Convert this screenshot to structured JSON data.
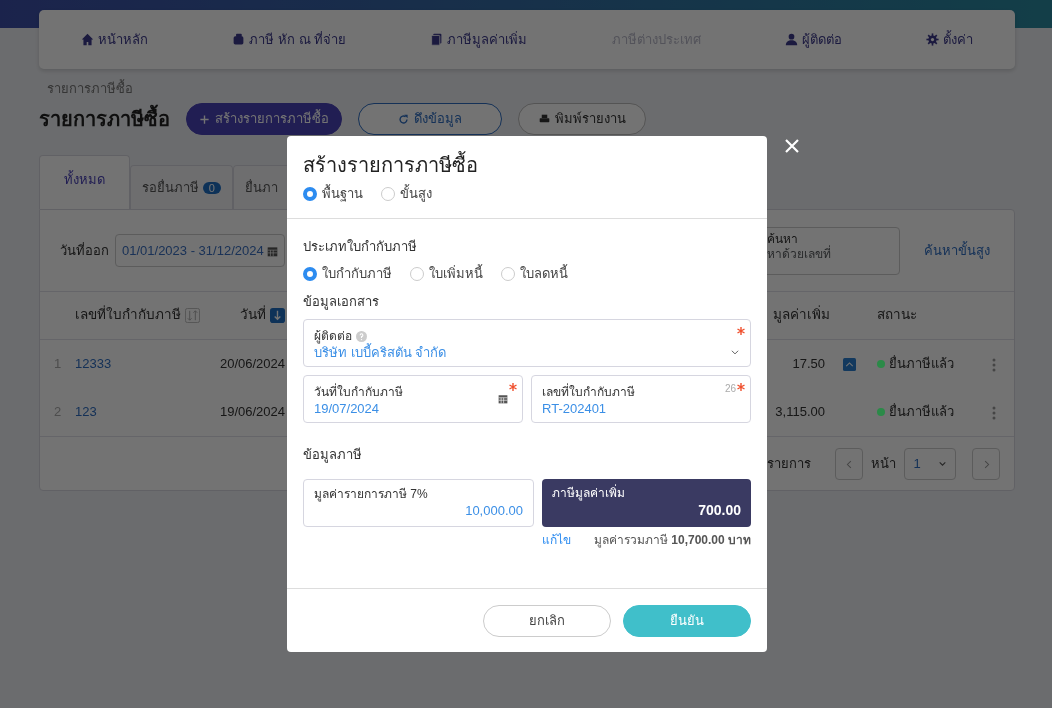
{
  "navbar": {
    "items": [
      {
        "label": "หน้าหลัก",
        "disabled": false
      },
      {
        "label": "ภาษี หัก ณ ที่จ่าย",
        "disabled": false
      },
      {
        "label": "ภาษีมูลค่าเพิ่ม",
        "disabled": false
      },
      {
        "label": "ภาษีต่างประเทศ",
        "disabled": true
      },
      {
        "label": "ผู้ติดต่อ",
        "disabled": false
      },
      {
        "label": "ตั้งค่า",
        "disabled": false
      }
    ]
  },
  "breadcrumb": "รายการภาษีซื้อ",
  "page_title": "รายการภาษีซื้อ",
  "actions": [
    {
      "label": "สร้างรายการภาษีซื้อ",
      "kind": "primary"
    },
    {
      "label": "ดึงข้อมูล",
      "kind": "outline"
    },
    {
      "label": "พิมพ์รายงาน",
      "kind": "secondary"
    }
  ],
  "tabs": [
    {
      "label": "ทั้งหมด",
      "selected": true
    },
    {
      "label": "รอยื่นภาษี",
      "count": "0",
      "selected": false
    },
    {
      "label": "ยื่นภา",
      "selected": false
    }
  ],
  "filters": {
    "date_label": "วันที่ออก",
    "date_range": "01/01/2023 - 31/12/2024",
    "search_label": "ค้นหา",
    "search_placeholder": "หาด้วยเลขที่",
    "advanced_link": "ค้นหาขั้นสูง"
  },
  "table": {
    "columns": [
      "เลขที่ใบกำกับภาษี",
      "วันที่",
      "มูลค่าเพิ่ม",
      "สถานะ"
    ],
    "rows": [
      {
        "index": "1",
        "number": "12333",
        "date": "20/06/2024",
        "vat": "17.50",
        "flagged": true,
        "status": "ยื่นภาษีแล้ว",
        "color": "#2b8a48"
      },
      {
        "index": "2",
        "number": "123",
        "date": "19/06/2024",
        "vat": "3,115.00",
        "flagged": false,
        "status": "ยื่นภาษีแล้ว",
        "color": "#2b8a48"
      }
    ]
  },
  "pagination": {
    "items_label": "รายการ",
    "page_label": "หน้า",
    "page": "1"
  },
  "modal": {
    "title": "สร้างรายการภาษีซื้อ",
    "modes": [
      {
        "label": "พื้นฐาน",
        "selected": true
      },
      {
        "label": "ขั้นสูง",
        "selected": false
      }
    ],
    "doc_type_label": "ประเภทใบกำกับภาษี",
    "doc_types": [
      {
        "label": "ใบกำกับภาษี",
        "selected": true
      },
      {
        "label": "ใบเพิ่มหนี้",
        "selected": false
      },
      {
        "label": "ใบลดหนี้",
        "selected": false
      }
    ],
    "doc_section": "ข้อมูลเอกสาร",
    "contact": {
      "label": "ผู้ติดต่อ",
      "value": "บริษัท เบบี้คริสตัน จำกัด",
      "required": true
    },
    "date": {
      "label": "วันที่ใบกำกับภาษี",
      "value": "19/07/2024",
      "required": true
    },
    "number": {
      "label": "เลขที่ใบกำกับภาษี",
      "value": "RT-202401",
      "counter": "26",
      "required": true
    },
    "tax_section": "ข้อมูลภาษี",
    "amount": {
      "label": "มูลค่ารายการภาษี 7%",
      "value": "10,000.00"
    },
    "vat": {
      "label": "ภาษีมูลค่าเพิ่ม",
      "value": "700.00"
    },
    "edit_link": "แก้ไข",
    "total": "มูลค่ารวมภาษี **10,700.00 บาท**",
    "buttons": [
      {
        "label": "ยกเลิก",
        "kind": "cancel"
      },
      {
        "label": "ยืนยัน",
        "kind": "confirm"
      }
    ]
  }
}
